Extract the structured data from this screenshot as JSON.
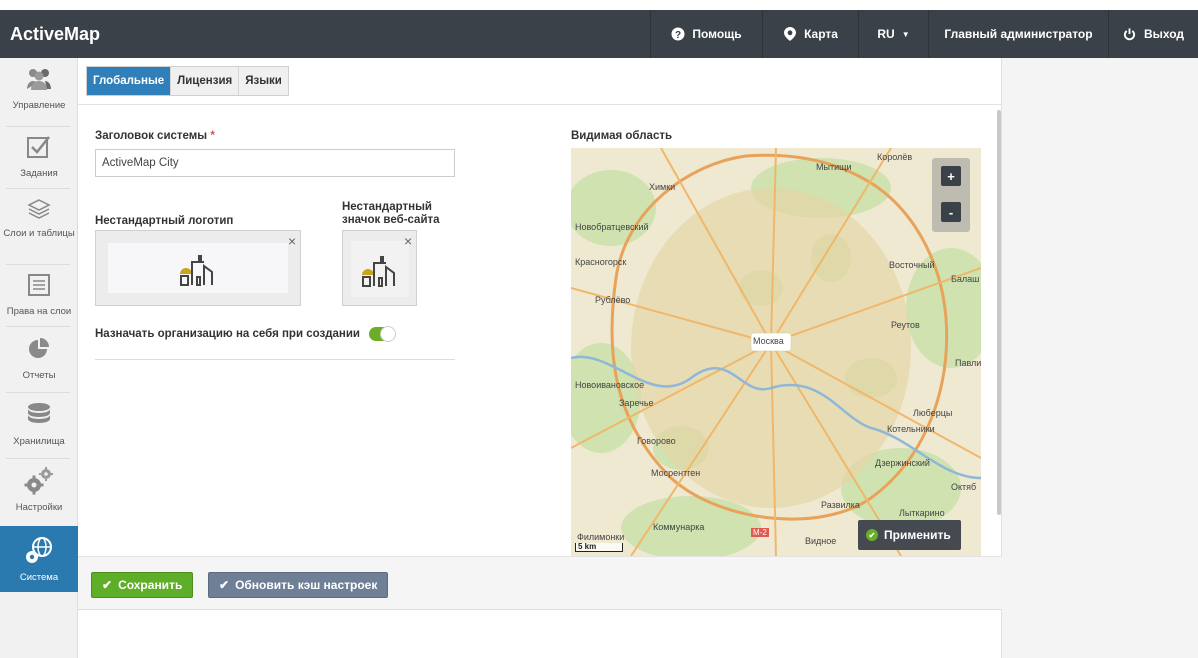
{
  "app": {
    "title": "ActiveMap"
  },
  "topnav": {
    "help": "Помощь",
    "map": "Карта",
    "lang": "RU",
    "user": "Главный администратор",
    "logout": "Выход"
  },
  "sidebar": {
    "items": [
      {
        "label": "Управление",
        "icon": "users-icon"
      },
      {
        "label": "Задания",
        "icon": "checkbox-icon"
      },
      {
        "label": "Слои и таблицы",
        "icon": "layers-icon"
      },
      {
        "label": "Права на слои",
        "icon": "list-icon"
      },
      {
        "label": "Отчеты",
        "icon": "pie-chart-icon"
      },
      {
        "label": "Хранилища",
        "icon": "database-icon"
      },
      {
        "label": "Настройки",
        "icon": "gears-icon"
      },
      {
        "label": "Система",
        "icon": "globe-gear-icon"
      }
    ],
    "active_index": 7
  },
  "tabs": [
    {
      "label": "Глобальные",
      "active": true
    },
    {
      "label": "Лицензия",
      "active": false
    },
    {
      "label": "Языки",
      "active": false
    }
  ],
  "form": {
    "system_title_label": "Заголовок системы",
    "required_mark": "*",
    "system_title_value": "ActiveMap City",
    "custom_logo_label": "Нестандартный логотип",
    "favicon_label_line1": "Нестандартный",
    "favicon_label_line2": "значок веб-сайта",
    "assign_org_label": "Назначать организацию на себя при создании",
    "assign_org_enabled": true,
    "visible_area_label": "Видимая область"
  },
  "map": {
    "labels": [
      "Мытищи",
      "Королёв",
      "Химки",
      "Новобратцевский",
      "Красногорск",
      "Восточный",
      "Балаш",
      "Рублёво",
      "Реутов",
      "Москва",
      "Новоивановское",
      "Заречье",
      "Люберцы",
      "Котельники",
      "Говорово",
      "Дзержинский",
      "Мосрентген",
      "Развилка",
      "Лыткарино",
      "Коммунарка",
      "Видное",
      "Филимонки",
      "Октяб",
      "Павли",
      "М-2"
    ],
    "scale_label": "5 km",
    "zoom_in": "+",
    "zoom_out": "-",
    "apply_label": "Применить"
  },
  "footer": {
    "save_label": "Сохранить",
    "refresh_label": "Обновить кэш настроек"
  },
  "colors": {
    "topbar": "#3a4148",
    "active_blue": "#2f7fbb",
    "save_green": "#5fae2a",
    "refresh_grey": "#6f7f96",
    "toggle_green": "#6aad27"
  }
}
